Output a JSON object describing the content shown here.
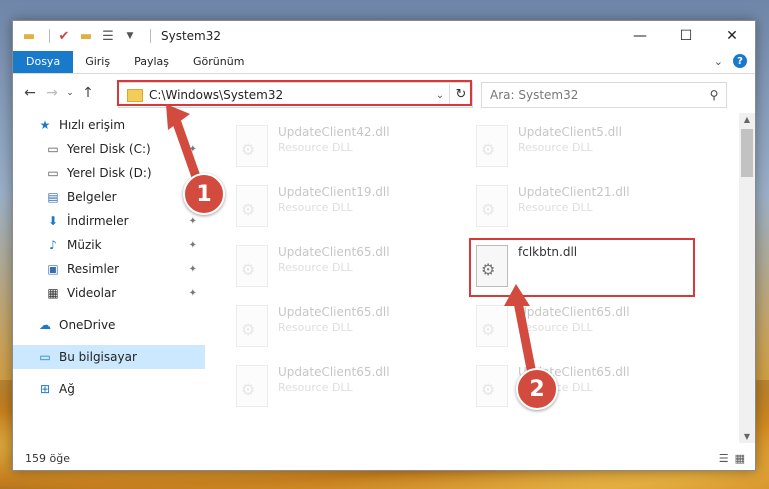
{
  "window": {
    "title": "System32",
    "controls": {
      "minimize": "—",
      "maximize": "☐",
      "close": "✕"
    }
  },
  "ribbon": {
    "tabs": [
      "Dosya",
      "Giriş",
      "Paylaş",
      "Görünüm"
    ],
    "help": "?"
  },
  "address": {
    "path": "C:\\Windows\\System32",
    "search_placeholder": "Ara: System32"
  },
  "sidebar": {
    "items": [
      {
        "label": "Hızlı erişim",
        "icon": "star-icon"
      },
      {
        "label": "Yerel Disk (C:)",
        "icon": "drive-icon"
      },
      {
        "label": "Yerel Disk (D:)",
        "icon": "drive-icon"
      },
      {
        "label": "Belgeler",
        "icon": "document-icon"
      },
      {
        "label": "İndirmeler",
        "icon": "download-icon"
      },
      {
        "label": "Müzik",
        "icon": "music-icon"
      },
      {
        "label": "Resimler",
        "icon": "image-icon"
      },
      {
        "label": "Videolar",
        "icon": "video-icon"
      },
      {
        "label": "OneDrive",
        "icon": "cloud-icon"
      },
      {
        "label": "Bu bilgisayar",
        "icon": "computer-icon"
      },
      {
        "label": "Ağ",
        "icon": "network-icon"
      }
    ]
  },
  "files": [
    {
      "name": "UpdateClient42.dll",
      "type": "Resource DLL"
    },
    {
      "name": "UpdateClient5.dll",
      "type": "Resource DLL"
    },
    {
      "name": "UpdateClient19.dll",
      "type": "Resource DLL"
    },
    {
      "name": "UpdateClient21.dll",
      "type": "Resource DLL"
    },
    {
      "name": "UpdateClient65.dll",
      "type": "Resource DLL"
    },
    {
      "name": "fclkbtn.dll",
      "type": ""
    },
    {
      "name": "UpdateClient65.dll",
      "type": "Resource DLL"
    },
    {
      "name": "UpdateClient65.dll",
      "type": "Resource DLL"
    },
    {
      "name": "UpdateClient65.dll",
      "type": "Resource DLL"
    },
    {
      "name": "UpdateClient65.dll",
      "type": "Resource DLL"
    }
  ],
  "status": {
    "count": "159 öğe"
  },
  "annotations": {
    "badge1": "1",
    "badge2": "2"
  },
  "colors": {
    "highlight": "#d9383a",
    "badge": "#d24b3e",
    "accent": "#1979ca"
  }
}
